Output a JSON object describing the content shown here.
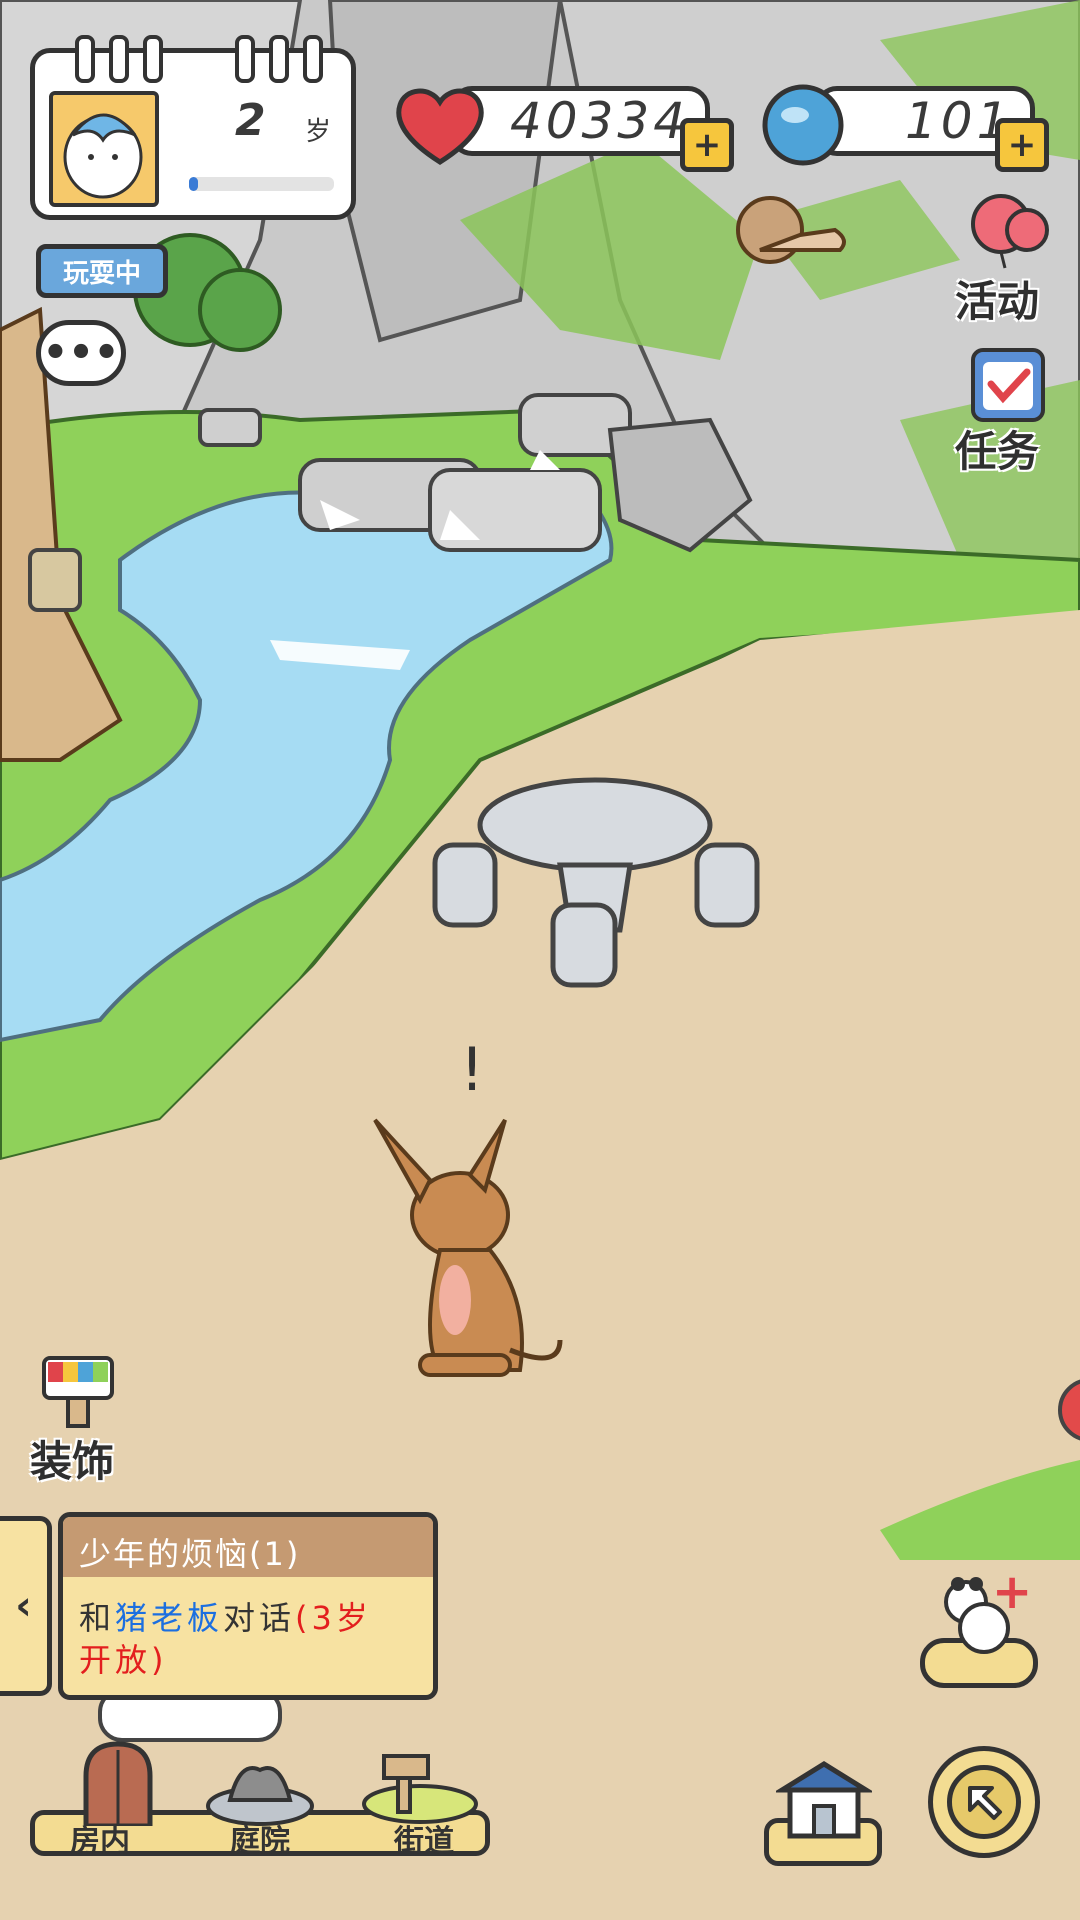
{
  "profile": {
    "age_value": "2",
    "age_unit": "岁",
    "growth_progress": 0.06
  },
  "status_badge": "玩耍中",
  "currencies": {
    "hearts": "40334",
    "gems": "101"
  },
  "side_menu": {
    "events_label": "活动",
    "tasks_label": "任务",
    "decorate_label": "装饰"
  },
  "quest": {
    "title": "少年的烦恼(1)",
    "line1_prefix": "和",
    "line1_highlight": "猪老板",
    "line1_verb": "对话",
    "line1_note": "(3岁",
    "line2_note": "开放)",
    "highlight_color": "#1c6fe0",
    "note_color": "#e31e1e"
  },
  "location_tabs": [
    {
      "label": "房内"
    },
    {
      "label": "庭院"
    },
    {
      "label": "街道"
    }
  ],
  "colors": {
    "sky_rock": "#c7c7c7",
    "grass": "#8fd15a",
    "water": "#a6dcf3",
    "ground": "#e6d2b0"
  }
}
